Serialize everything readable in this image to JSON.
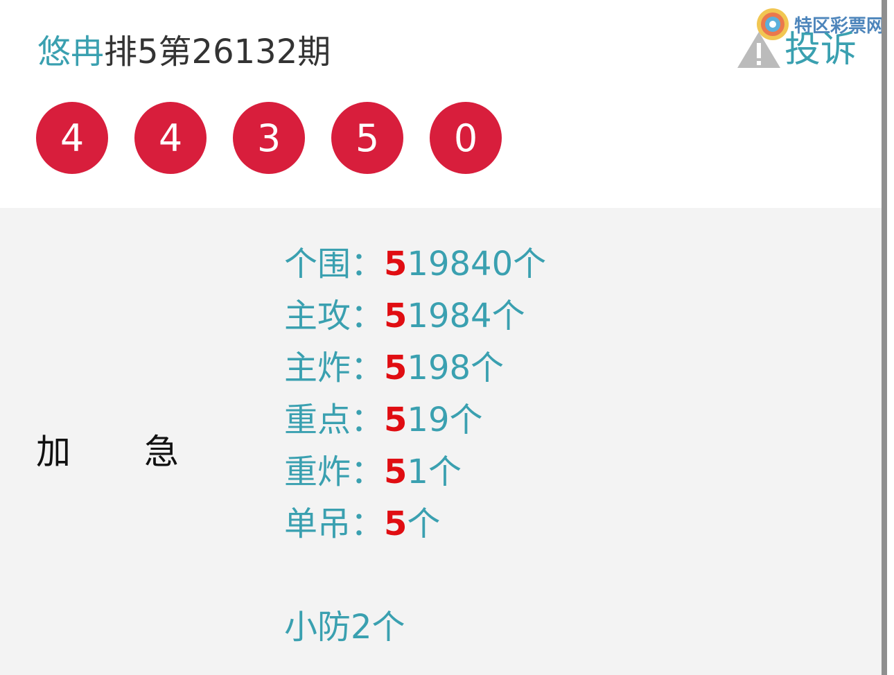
{
  "header": {
    "author": "悠冉",
    "title_suffix": "排5第26132期",
    "complain_label": "投诉"
  },
  "watermark": {
    "text": "特区彩票网"
  },
  "numbers": [
    "4",
    "4",
    "3",
    "5",
    "0"
  ],
  "tags": [
    "加",
    "急"
  ],
  "stats": [
    {
      "label": "个围：",
      "highlight": "5",
      "rest": "19840个"
    },
    {
      "label": "主攻：",
      "highlight": "5",
      "rest": "1984个"
    },
    {
      "label": "主炸：",
      "highlight": "5",
      "rest": "198个"
    },
    {
      "label": "重点：",
      "highlight": "5",
      "rest": "19个"
    },
    {
      "label": "重炸：",
      "highlight": "5",
      "rest": "1个"
    },
    {
      "label": "单吊：",
      "highlight": "5",
      "rest": "个"
    }
  ],
  "extra": "小防2个",
  "colors": {
    "accent": "#3aa0b0",
    "ball": "#d81e3c",
    "highlight": "#e00d12"
  }
}
